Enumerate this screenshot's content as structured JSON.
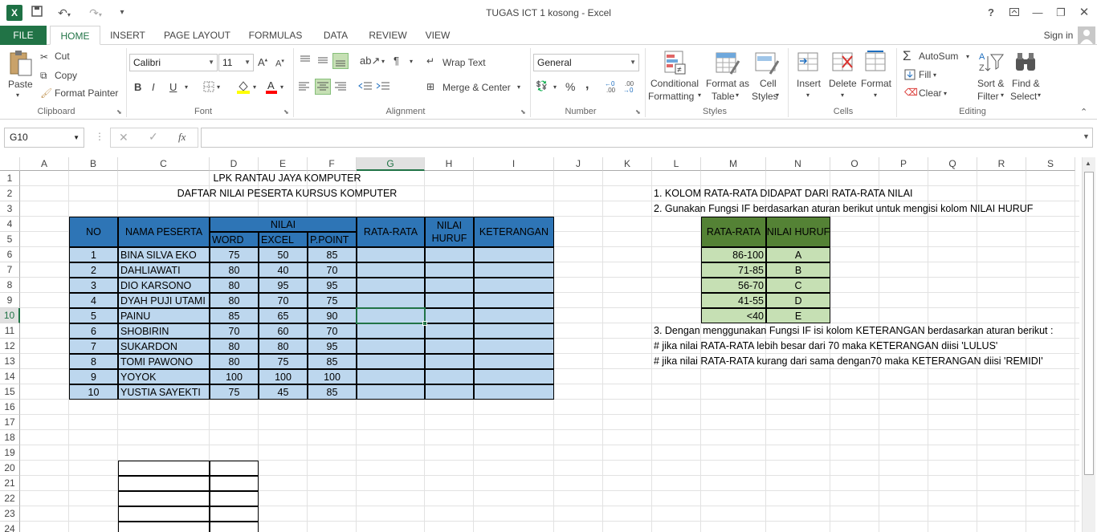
{
  "window": {
    "title": "TUGAS ICT 1 kosong - Excel",
    "help": "?",
    "signin": "Sign in"
  },
  "tabs": [
    "FILE",
    "HOME",
    "INSERT",
    "PAGE LAYOUT",
    "FORMULAS",
    "DATA",
    "REVIEW",
    "VIEW"
  ],
  "ribbon": {
    "clipboard": {
      "paste": "Paste",
      "cut": "Cut",
      "copy": "Copy",
      "format_painter": "Format Painter",
      "label": "Clipboard"
    },
    "font": {
      "name": "Calibri",
      "size": "11",
      "bold": "B",
      "italic": "I",
      "underline": "U",
      "label": "Font"
    },
    "alignment": {
      "wrap": "Wrap Text",
      "merge": "Merge & Center",
      "label": "Alignment"
    },
    "number": {
      "format": "General",
      "percent": "%",
      "comma": ",",
      "label": "Number"
    },
    "styles": {
      "cond1": "Conditional",
      "cond2": "Formatting",
      "fat1": "Format as",
      "fat2": "Table",
      "cs1": "Cell",
      "cs2": "Styles",
      "label": "Styles"
    },
    "cells": {
      "insert": "Insert",
      "delete": "Delete",
      "format": "Format",
      "label": "Cells"
    },
    "editing": {
      "autosum": "AutoSum",
      "fill": "Fill",
      "clear": "Clear",
      "sort1": "Sort &",
      "sort2": "Filter",
      "find1": "Find &",
      "find2": "Select",
      "label": "Editing"
    }
  },
  "formula_bar": {
    "name_box": "G10",
    "fx": "fx",
    "content": ""
  },
  "columns": [
    "A",
    "B",
    "C",
    "D",
    "E",
    "F",
    "G",
    "H",
    "I",
    "J",
    "K",
    "L",
    "M",
    "N",
    "O",
    "P",
    "Q",
    "R",
    "S"
  ],
  "rows": [
    "1",
    "2",
    "3",
    "4",
    "5",
    "6",
    "7",
    "8",
    "9",
    "10",
    "11",
    "12",
    "13",
    "14",
    "15",
    "16",
    "17",
    "18",
    "19",
    "20",
    "21",
    "22",
    "23",
    "24"
  ],
  "sheet": {
    "title1": "LPK RANTAU JAYA KOMPUTER",
    "title2": "DAFTAR NILAI PESERTA KURSUS KOMPUTER",
    "headers": {
      "no": "NO",
      "nama": "NAMA PESERTA",
      "nilai": "NILAI",
      "word": "WORD",
      "excel": "EXCEL",
      "ppoint": "P.POINT",
      "rata": "RATA-RATA",
      "huruf1": "NILAI",
      "huruf2": "HURUF",
      "ket": "KETERANGAN"
    },
    "students": [
      {
        "no": "1",
        "nama": "BINA SILVA EKO",
        "word": "75",
        "excel": "50",
        "pp": "85"
      },
      {
        "no": "2",
        "nama": "DAHLIAWATI",
        "word": "80",
        "excel": "40",
        "pp": "70"
      },
      {
        "no": "3",
        "nama": "DIO KARSONO",
        "word": "80",
        "excel": "95",
        "pp": "95"
      },
      {
        "no": "4",
        "nama": "DYAH PUJI UTAMI",
        "word": "80",
        "excel": "70",
        "pp": "75"
      },
      {
        "no": "5",
        "nama": "PAINU",
        "word": "85",
        "excel": "65",
        "pp": "90"
      },
      {
        "no": "6",
        "nama": "SHOBIRIN",
        "word": "70",
        "excel": "60",
        "pp": "70"
      },
      {
        "no": "7",
        "nama": "SUKARDON",
        "word": "80",
        "excel": "80",
        "pp": "95"
      },
      {
        "no": "8",
        "nama": "TOMI PAWONO",
        "word": "80",
        "excel": "75",
        "pp": "85"
      },
      {
        "no": "9",
        "nama": "YOYOK",
        "word": "100",
        "excel": "100",
        "pp": "100"
      },
      {
        "no": "10",
        "nama": "YUSTIA SAYEKTI",
        "word": "75",
        "excel": "45",
        "pp": "85"
      }
    ],
    "instructions": {
      "i1": "1. KOLOM RATA-RATA DIDAPAT DARI RATA-RATA NILAI",
      "i2": "2. Gunakan Fungsi IF berdasarkan aturan berikut untuk mengisi kolom NILAI HURUF",
      "i3": "3. Dengan menggunakan Fungsi IF isi kolom KETERANGAN berdasarkan aturan berikut :",
      "i4": "# jika nilai RATA-RATA lebih besar dari 70 maka KETERANGAN diisi 'LULUS'",
      "i5": "# jika nilai RATA-RATA kurang dari sama dengan70 maka KETERANGAN diisi 'REMIDI'"
    },
    "grade_table": {
      "h1": "RATA-RATA",
      "h2": "NILAI HURUF",
      "rows": [
        {
          "range": "86-100",
          "grade": "A"
        },
        {
          "range": "71-85",
          "grade": "B"
        },
        {
          "range": "56-70",
          "grade": "C"
        },
        {
          "range": "41-55",
          "grade": "D"
        },
        {
          "range": "<40",
          "grade": "E"
        }
      ]
    }
  },
  "colors": {
    "excel_green": "#217346",
    "header_blue": "#2e75b6",
    "cell_blue": "#bdd7ee",
    "grade_header": "#548235",
    "grade_cell": "#c6e0b4"
  }
}
